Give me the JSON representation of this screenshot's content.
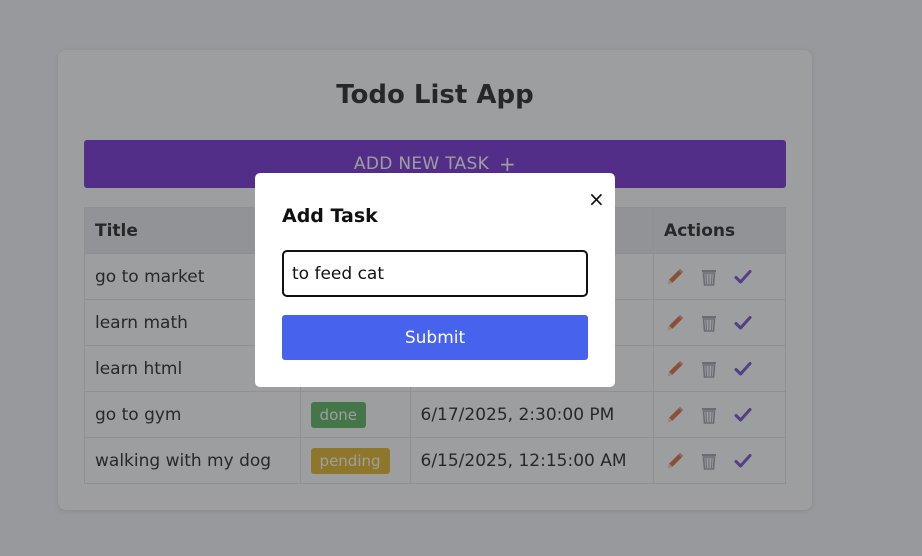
{
  "app": {
    "title": "Todo List App",
    "add_button": {
      "label": "ADD NEW TASK",
      "icon": "plus-icon",
      "color": "#6a1fd1"
    }
  },
  "table": {
    "headers": {
      "title": "Title",
      "actions": "Actions"
    },
    "rows": [
      {
        "title": "go to market",
        "status": "",
        "date": ""
      },
      {
        "title": "learn math",
        "status": "",
        "date": ""
      },
      {
        "title": "learn html",
        "status": "",
        "date": ""
      },
      {
        "title": "go to gym",
        "status": "done",
        "status_color": "#4caf50",
        "date": "6/17/2025, 2:30:00 PM"
      },
      {
        "title": "walking with my dog",
        "status": "pending",
        "status_color": "#e0b012",
        "date": "6/15/2025, 12:15:00 AM"
      }
    ],
    "action_icons": [
      "pencil-icon",
      "trash-icon",
      "checkmark-icon"
    ]
  },
  "modal": {
    "title": "Add Task",
    "close_icon": "close-icon",
    "close_label": "×",
    "input_value": "to feed cat",
    "submit_label": "Submit",
    "submit_color": "#4763ee"
  }
}
